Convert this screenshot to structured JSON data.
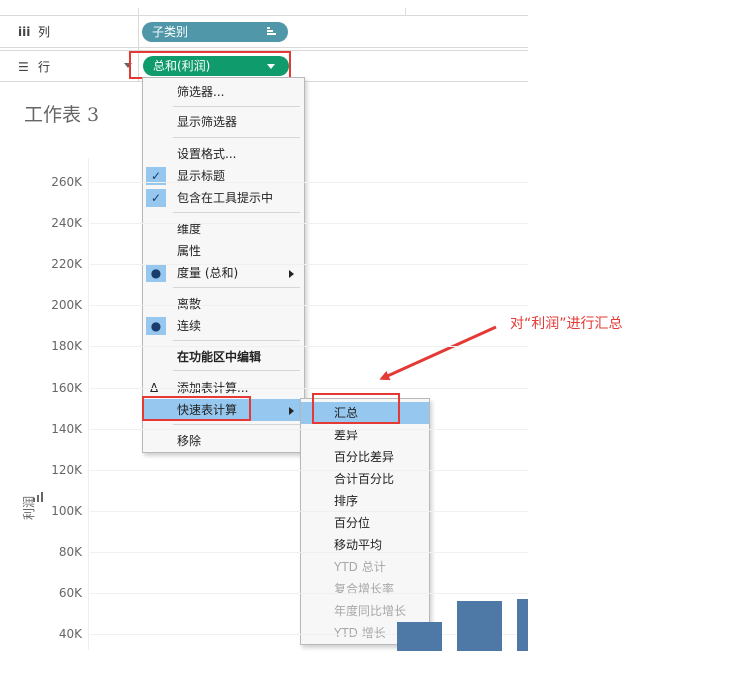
{
  "shelves": {
    "columns": {
      "label": "列",
      "icon": "columns-icon",
      "pill": "子类别"
    },
    "rows": {
      "label": "行",
      "icon": "rows-icon",
      "pill": "总和(利润)"
    }
  },
  "sheet": {
    "title": "工作表 3"
  },
  "chart_data": {
    "type": "bar",
    "ylabel": "利润",
    "y_ticks": [
      "260K",
      "240K",
      "220K",
      "200K",
      "180K",
      "160K",
      "140K",
      "120K",
      "100K",
      "80K",
      "60K",
      "40K"
    ],
    "ylim": [
      40000,
      260000
    ],
    "visible_bars": [
      {
        "value": 46000
      },
      {
        "value": 56000
      },
      {
        "value": 57000
      }
    ],
    "bar_color": "#4e79a7"
  },
  "context_menu": {
    "items": [
      {
        "label": "筛选器..."
      },
      {
        "label": "显示筛选器"
      },
      {
        "label": "设置格式..."
      },
      {
        "label": "显示标题",
        "checked": true
      },
      {
        "label": "包含在工具提示中",
        "checked": true
      },
      {
        "label": "维度"
      },
      {
        "label": "属性"
      },
      {
        "label": "度量 (总和)",
        "selected": true,
        "submenu": true
      },
      {
        "label": "离散"
      },
      {
        "label": "连续",
        "selected": true
      },
      {
        "label": "在功能区中编辑"
      },
      {
        "label": "添加表计算..."
      },
      {
        "label": "快速表计算",
        "submenu": true,
        "highlighted": true
      },
      {
        "label": "移除"
      }
    ]
  },
  "quick_calc_menu": {
    "items": [
      {
        "label": "汇总",
        "highlighted": true
      },
      {
        "label": "差异"
      },
      {
        "label": "百分比差异"
      },
      {
        "label": "合计百分比"
      },
      {
        "label": "排序"
      },
      {
        "label": "百分位"
      },
      {
        "label": "移动平均"
      },
      {
        "label": "YTD 总计",
        "disabled": true
      },
      {
        "label": "复合增长率",
        "disabled": true
      },
      {
        "label": "年度同比增长",
        "disabled": true
      },
      {
        "label": "YTD 增长",
        "disabled": true
      }
    ]
  },
  "annotation": {
    "text": "对“利润”进行汇总",
    "color": "#e53935"
  },
  "colors": {
    "dimension_pill": "#4f97a9",
    "measure_pill": "#0f9b6b",
    "menu_highlight": "#95c7ef",
    "callout_red": "#e53935"
  }
}
